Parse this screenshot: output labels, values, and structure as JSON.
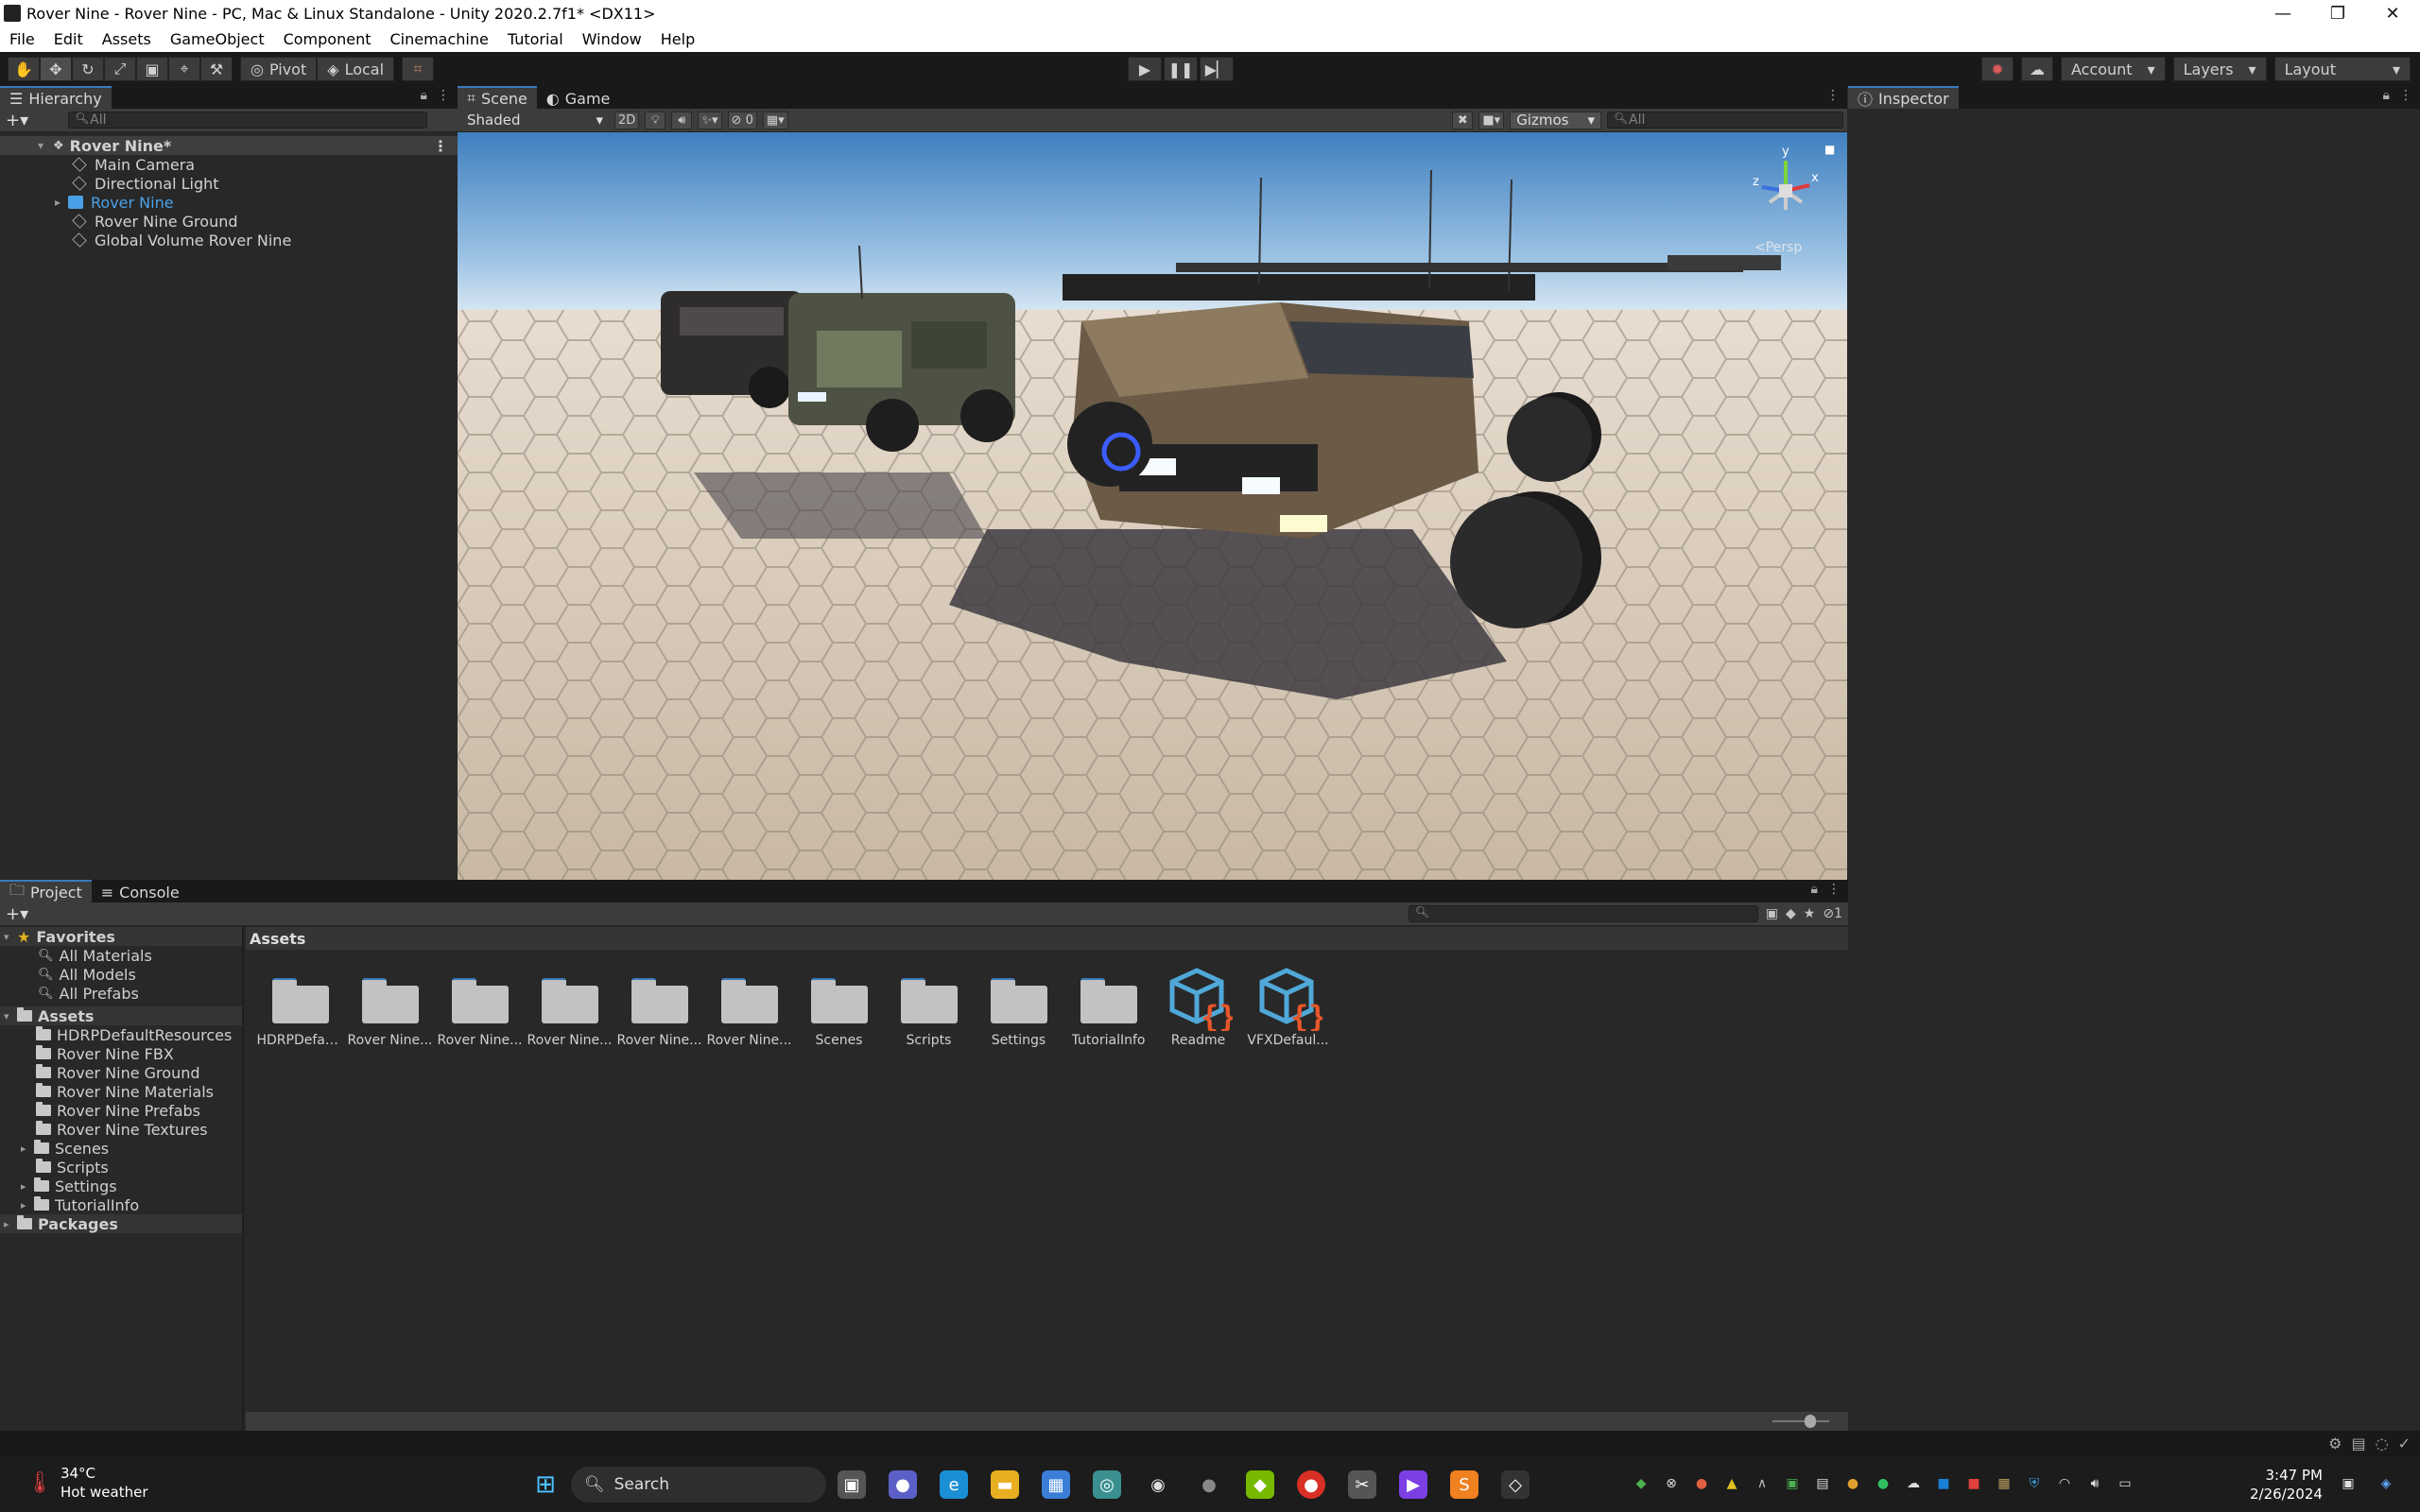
{
  "window": {
    "title": "Rover Nine - Rover Nine - PC, Mac & Linux Standalone - Unity 2020.2.7f1* <DX11>"
  },
  "menu": [
    "File",
    "Edit",
    "Assets",
    "GameObject",
    "Component",
    "Cinemachine",
    "Tutorial",
    "Window",
    "Help"
  ],
  "toolbar": {
    "pivot_label": "Pivot",
    "local_label": "Local",
    "account_label": "Account",
    "layers_label": "Layers",
    "layout_label": "Layout"
  },
  "hierarchy": {
    "tab_label": "Hierarchy",
    "search_placeholder": "All",
    "scene_name": "Rover Nine*",
    "items": [
      {
        "label": "Main Camera"
      },
      {
        "label": "Directional Light"
      },
      {
        "label": "Rover Nine"
      },
      {
        "label": "Rover Nine Ground"
      },
      {
        "label": "Global Volume Rover Nine"
      }
    ]
  },
  "scene": {
    "tab_scene": "Scene",
    "tab_game": "Game",
    "shading_mode": "Shaded",
    "mode_2d": "2D",
    "hidden_count": "0",
    "gizmos_label": "Gizmos",
    "search_placeholder": "All",
    "persp_label": "Persp",
    "axis_labels": {
      "y": "y",
      "z": "z",
      "x": "x"
    }
  },
  "inspector": {
    "tab_label": "Inspector"
  },
  "project": {
    "tab_project": "Project",
    "tab_console": "Console",
    "hidden_count": "1",
    "tree": {
      "favorites_label": "Favorites",
      "favorites": [
        "All Materials",
        "All Models",
        "All Prefabs"
      ],
      "assets_label": "Assets",
      "asset_folders": [
        {
          "label": "HDRPDefaultResources",
          "expandable": false
        },
        {
          "label": "Rover Nine FBX",
          "expandable": false
        },
        {
          "label": "Rover Nine Ground",
          "expandable": false
        },
        {
          "label": "Rover Nine Materials",
          "expandable": false
        },
        {
          "label": "Rover Nine Prefabs",
          "expandable": false
        },
        {
          "label": "Rover Nine Textures",
          "expandable": false
        },
        {
          "label": "Scenes",
          "expandable": true
        },
        {
          "label": "Scripts",
          "expandable": false
        },
        {
          "label": "Settings",
          "expandable": true
        },
        {
          "label": "TutorialInfo",
          "expandable": true
        }
      ],
      "packages_label": "Packages"
    },
    "breadcrumb": "Assets",
    "grid": [
      {
        "label": "HDRPDefau...",
        "kind": "folder"
      },
      {
        "label": "Rover Nine...",
        "kind": "folder"
      },
      {
        "label": "Rover Nine...",
        "kind": "folder"
      },
      {
        "label": "Rover Nine...",
        "kind": "folder"
      },
      {
        "label": "Rover Nine...",
        "kind": "folder"
      },
      {
        "label": "Rover Nine...",
        "kind": "folder"
      },
      {
        "label": "Scenes",
        "kind": "folder"
      },
      {
        "label": "Scripts",
        "kind": "folder"
      },
      {
        "label": "Settings",
        "kind": "folder"
      },
      {
        "label": "TutorialInfo",
        "kind": "folder"
      },
      {
        "label": "Readme",
        "kind": "asset"
      },
      {
        "label": "VFXDefaul...",
        "kind": "asset"
      }
    ]
  },
  "taskbar": {
    "weather_temp": "34°C",
    "weather_desc": "Hot weather",
    "search_label": "Search",
    "time": "3:47 PM",
    "date": "2/26/2024"
  },
  "colors": {
    "accent": "#3a79bb",
    "selection_text": "#4aa0e6",
    "asset_icon": "#4fa8d8",
    "asset_brace": "#e8562a"
  }
}
